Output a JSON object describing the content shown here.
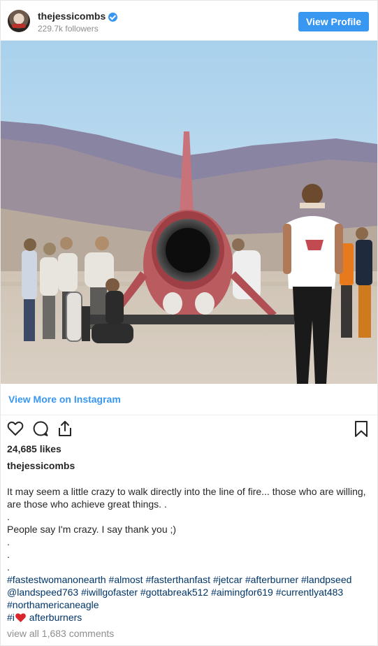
{
  "header": {
    "username": "thejessicombs",
    "followers": "229.7k followers",
    "view_profile": "View Profile"
  },
  "link": {
    "view_more": "View More on Instagram"
  },
  "post": {
    "likes": "24,685 likes",
    "author": "thejessicombs",
    "caption": {
      "line1": "It may seem a little crazy to walk directly into the line of fire... those who are willing,",
      "line2": "are those who achieve great things. .",
      "dot1": ".",
      "line3": "People say I'm crazy. I say thank you ;)",
      "dot2": ".",
      "dot3": ".",
      "dot4": ".",
      "tags1": "#fastestwomanonearth #almost #fasterthanfast #jetcar #afterburner #landpseed",
      "tags2": "@landspeed763 #iwillgofaster #gottabreak512 #aimingfor619 #currentlyat483",
      "tags3": "#northamericaneagle",
      "tags4_prefix": "#i",
      "tags4_suffix": " afterburners"
    },
    "view_comments": "view all 1,683 comments"
  },
  "icons": {
    "like": "heart-icon",
    "comment": "comment-icon",
    "share": "share-icon",
    "save": "bookmark-icon"
  },
  "colors": {
    "accent": "#3897f0",
    "hashtag": "#003569",
    "muted": "#8e8e8e",
    "text": "#262626"
  }
}
